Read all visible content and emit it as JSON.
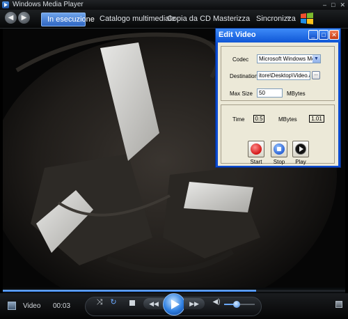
{
  "window": {
    "title": "Windows Media Player",
    "controls": [
      "minimize-icon",
      "maximize-icon",
      "close-icon"
    ],
    "control_glyphs": [
      "–",
      "□",
      "✕"
    ]
  },
  "nav": {
    "back_icon": "back-arrow-icon",
    "forward_icon": "forward-arrow-icon",
    "tabs": [
      {
        "label": "In esecuzione",
        "active": true
      },
      {
        "label": "Catalogo multimediale",
        "active": false
      },
      {
        "label": "Copia da CD",
        "active": false
      },
      {
        "label": "Masterizza",
        "active": false
      },
      {
        "label": "Sincronizza",
        "active": false
      }
    ],
    "more_glyph": "»",
    "logo_icon": "windows-media-logo-icon"
  },
  "dialog": {
    "title": "Edit Video",
    "codec_label": "Codec",
    "codec_value": "Microsoft Windows Media",
    "destination_label": "Destination",
    "destination_value": "itore\\Desktop\\Video.avi",
    "browse_label": "...",
    "maxsize_label": "Max Size",
    "maxsize_value": "50",
    "maxsize_unit": "MBytes",
    "time_label": "Time",
    "time_value": "0.5",
    "mbytes_label": "MBytes",
    "mbytes_value": "1.01",
    "buttons": {
      "start": "Start",
      "stop": "Stop",
      "play": "Play"
    },
    "colors": {
      "frame": "#0a4ad0",
      "titlebar": "#2f7cf0",
      "body": "#ece9d8"
    }
  },
  "player": {
    "media_label": "Video",
    "time": "00:03",
    "seek_fraction": 0.74,
    "volume_fraction": 0.4,
    "icons": [
      "shuffle-icon",
      "repeat-icon",
      "stop-icon",
      "previous-icon",
      "play-icon",
      "next-icon",
      "volume-icon"
    ]
  },
  "colors": {
    "accent": "#2f7fe0",
    "chrome": "#0b0c0d"
  }
}
